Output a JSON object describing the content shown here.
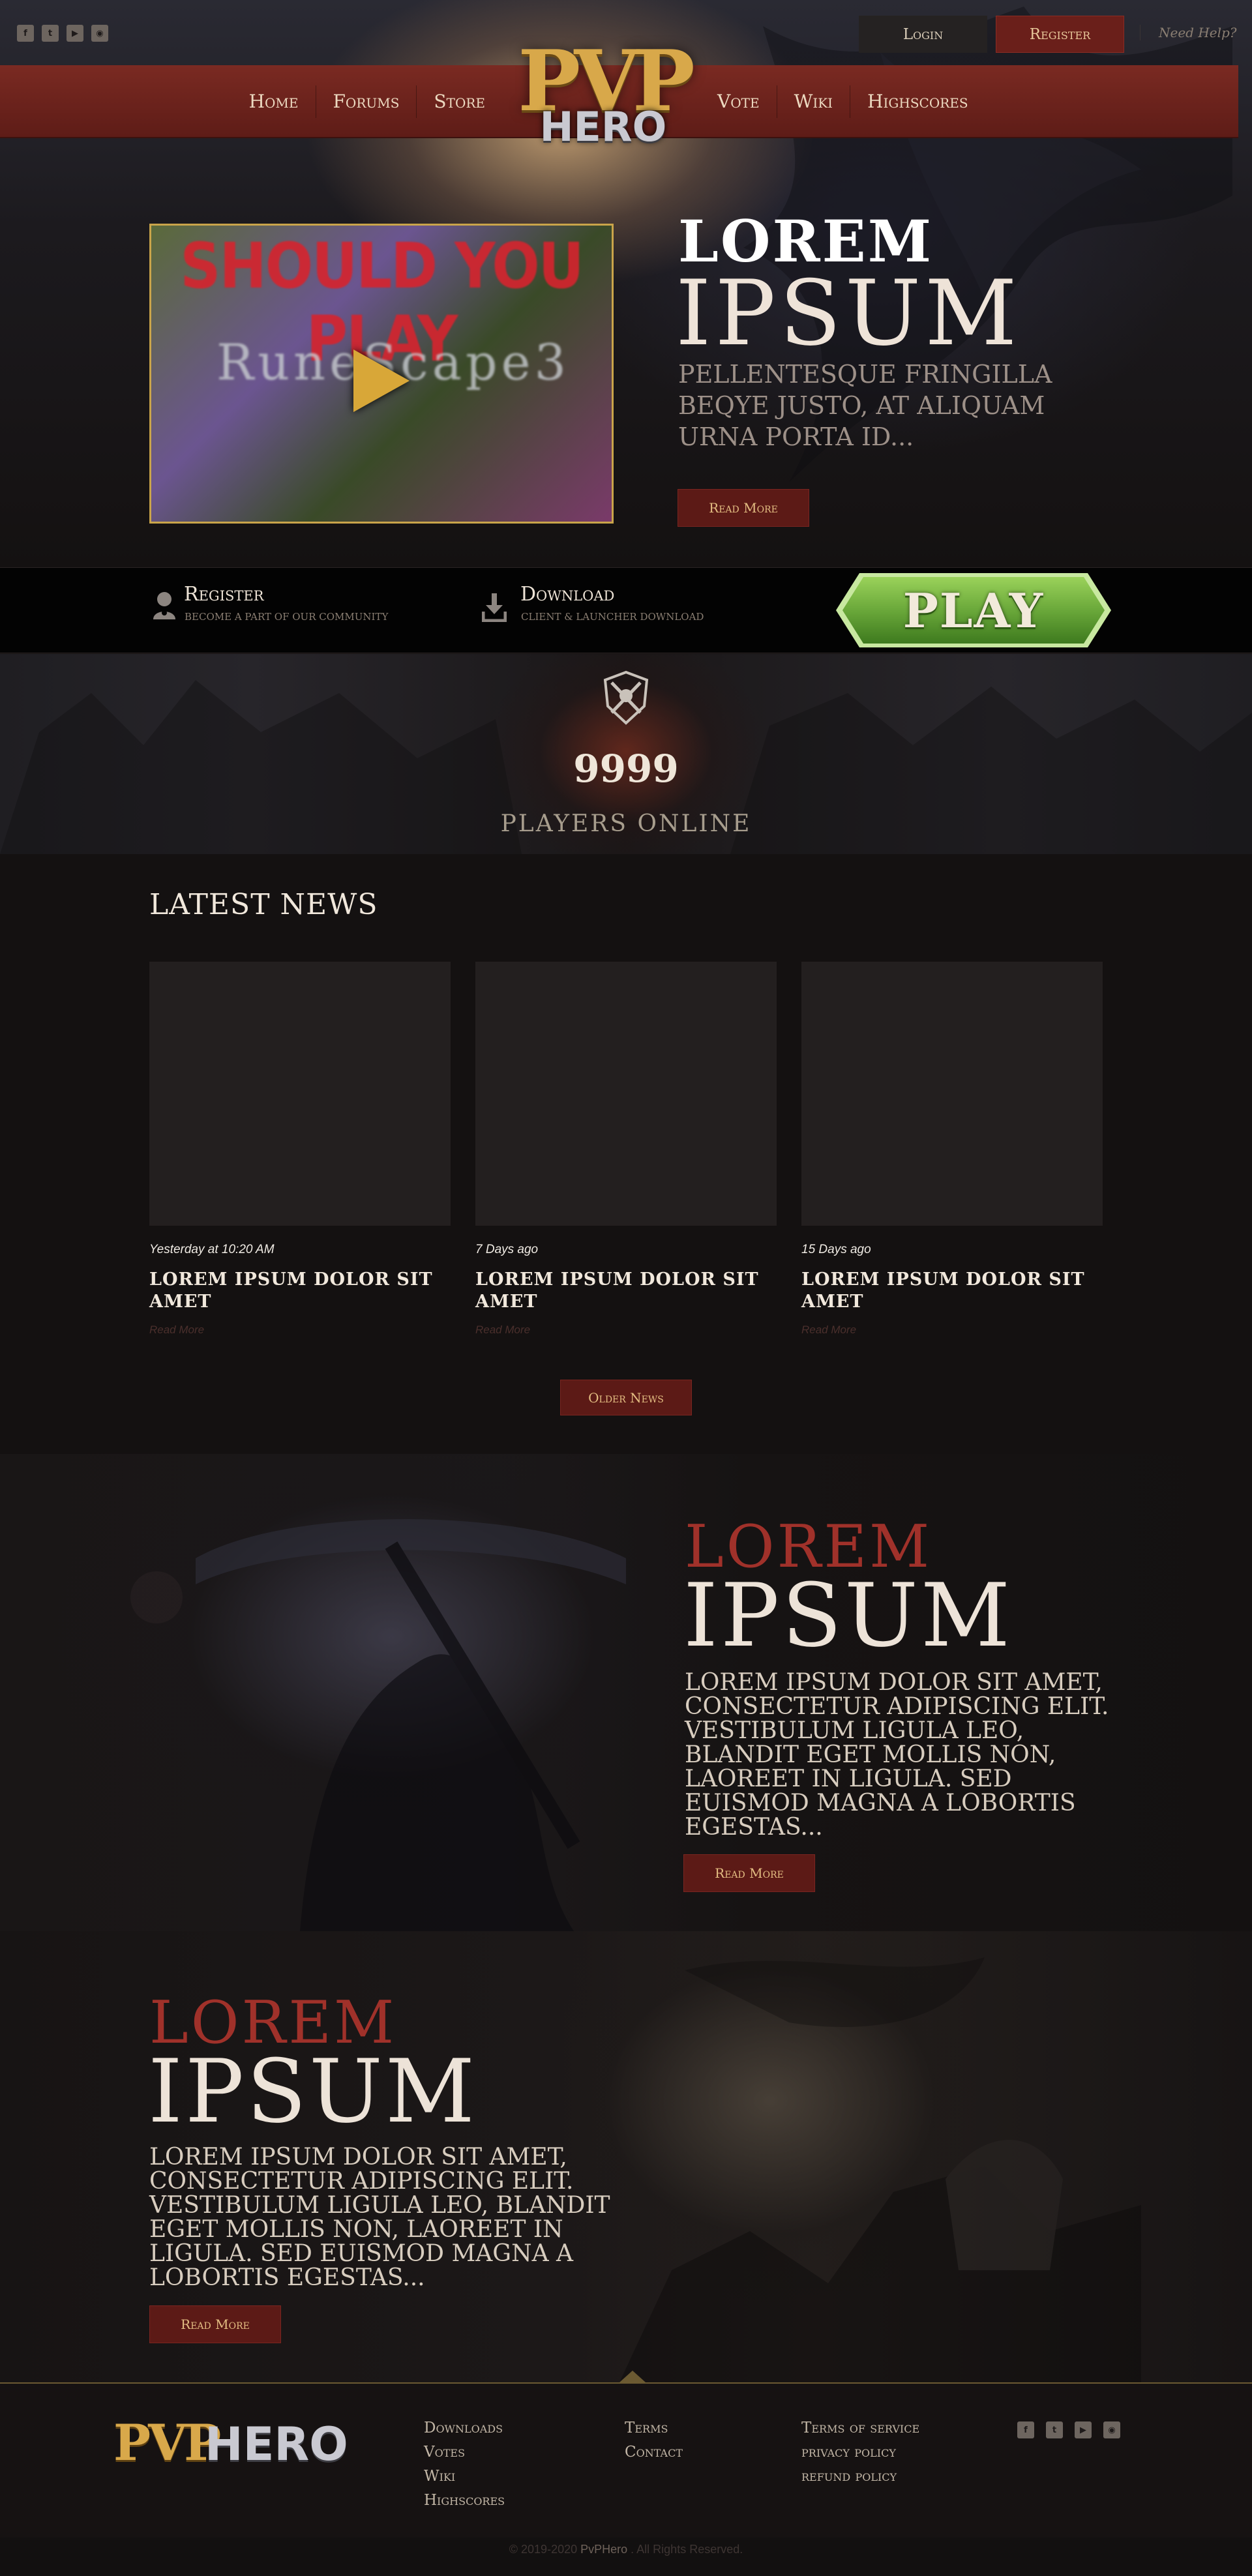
{
  "header": {
    "social": [
      {
        "icon": "facebook-icon",
        "glyph": "f"
      },
      {
        "icon": "twitter-icon",
        "glyph": "t"
      },
      {
        "icon": "youtube-icon",
        "glyph": "▶"
      },
      {
        "icon": "discord-icon",
        "glyph": "◉"
      }
    ],
    "login_label": "Login",
    "register_label": "Register",
    "help_label": "Need Help?"
  },
  "nav": {
    "left": [
      "Home",
      "Forums",
      "Store"
    ],
    "right": [
      "Vote",
      "Wiki",
      "Highscores"
    ]
  },
  "logo": {
    "pvp": "PVP",
    "hero": "HERO"
  },
  "hero": {
    "video_title": "SHOULD YOU PLAY",
    "video_game": "RuneScape3",
    "lorem": "LOREM",
    "ipsum": "IPSUM",
    "description": "Pellentesque fringilla beqye justo, at aliquam urna porta id...",
    "read_more": "Read More"
  },
  "actions": {
    "register_title": "Register",
    "register_sub": "Become a part of our community",
    "download_title": "Download",
    "download_sub": "Client & Launcher Download",
    "play_label": "PLAY"
  },
  "players": {
    "count": "9999",
    "label": "Players Online"
  },
  "news": {
    "title": "Latest News",
    "items": [
      {
        "date": "Yesterday at 10:20 AM",
        "title": "Lorem ipsum dolor  sit amet",
        "read_more": "Read More"
      },
      {
        "date": "7 Days ago",
        "title": "Lorem ipsum dolor  sit amet",
        "read_more": "Read More"
      },
      {
        "date": "15 Days ago",
        "title": "Lorem ipsum dolor  sit amet",
        "read_more": "Read More"
      }
    ],
    "older_label": "Older News"
  },
  "feature1": {
    "lorem": "LOREM",
    "ipsum": "IPSUM",
    "description": "Lorem ipsum dolor sit amet, consectetur adipiscing elit. Vestibulum ligula leo, blandit eget mollis non, laoreet in ligula. Sed euismod magna a lobortis egestas...",
    "read_more": "Read More"
  },
  "feature2": {
    "lorem": "LOREM",
    "ipsum": "IPSUM",
    "description": "Lorem ipsum dolor sit amet, consectetur adipiscing elit. Vestibulum ligula leo, blandit eget mollis non, laoreet in ligula. Sed euismod magna a lobortis egestas...",
    "read_more": "Read More"
  },
  "footer": {
    "logo_pvp": "PVP",
    "logo_hero": "HERO",
    "col1": [
      "Downloads",
      "Votes",
      "Wiki",
      "Highscores"
    ],
    "col2": [
      "Terms",
      "Contact"
    ],
    "col3": [
      "Terms of service",
      "privacy policy",
      "refund policy"
    ],
    "copyright_pre": "© 2019-2020 ",
    "copyright_brand": "PvPHero",
    "copyright_post": " . All Rights Reserved."
  },
  "colors": {
    "accent_red": "#6a1f1a",
    "gold": "#d8a84a",
    "play_green": "#6aa83a",
    "background": "#141111"
  }
}
